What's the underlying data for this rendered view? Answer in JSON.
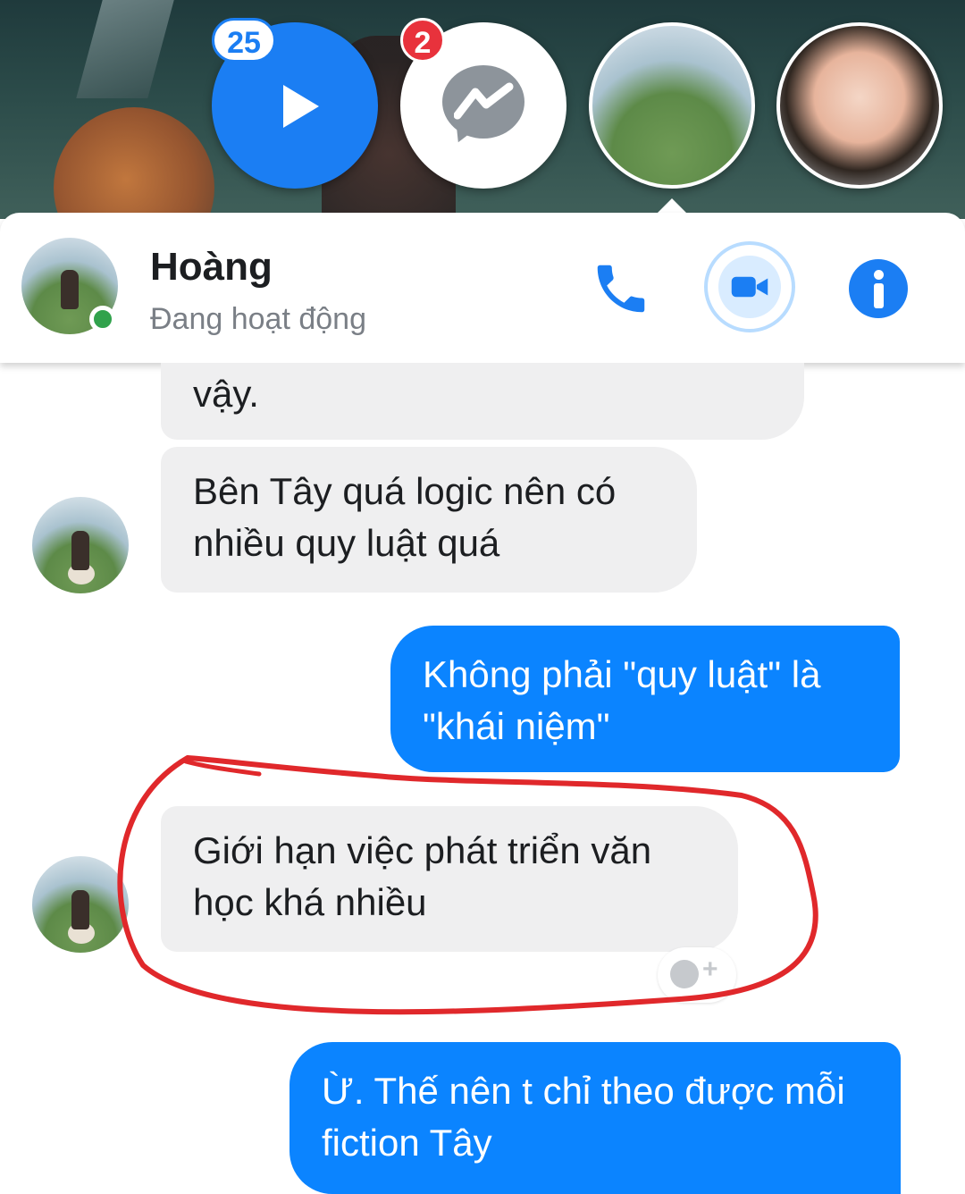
{
  "chat_heads": {
    "video_badge": "25",
    "messenger_badge": "2"
  },
  "header": {
    "name": "Hoàng",
    "status": "Đang hoạt động"
  },
  "messages": [
    {
      "side": "incoming",
      "text": "vậy."
    },
    {
      "side": "incoming",
      "text": "Bên Tây quá logic nên có nhiều quy luật quá"
    },
    {
      "side": "outgoing",
      "text": "Không phải \"quy luật\" là \"khái niệm\""
    },
    {
      "side": "incoming",
      "text": "Giới hạn việc phát triển văn học khá nhiều"
    },
    {
      "side": "outgoing",
      "text": "Ừ. Thế nên t chỉ theo được mỗi fiction Tây"
    }
  ],
  "colors": {
    "messenger_blue": "#0b84ff",
    "incoming_bubble": "#efeff0",
    "annotation_red": "#e0282b",
    "online_green": "#31a24c"
  },
  "icons": [
    "play-icon",
    "messenger-icon",
    "phone-icon",
    "video-camera-icon",
    "info-icon",
    "add-reaction-icon"
  ]
}
